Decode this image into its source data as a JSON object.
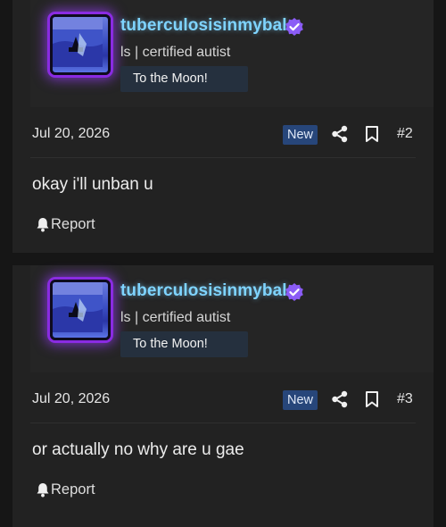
{
  "posts": [
    {
      "username": "tuberculosisinmybal",
      "user_title": "ls | certified autist",
      "banner": "To the Moon!",
      "date": "Jul 20, 2026",
      "badge": "New",
      "post_number": "#2",
      "message": "okay i'll unban u",
      "report_label": "Report"
    },
    {
      "username": "tuberculosisinmybal",
      "user_title": "ls | certified autist",
      "banner": "To the Moon!",
      "date": "Jul 20, 2026",
      "badge": "New",
      "post_number": "#3",
      "message": "or actually no why are u gae",
      "report_label": "Report"
    }
  ],
  "icons": {
    "verified": "verified-badge-icon",
    "share": "share-icon",
    "bookmark": "bookmark-icon",
    "report": "bell-icon"
  },
  "colors": {
    "username": "#7fd4ff",
    "verified": "#8b5cf6",
    "avatar_glow": "#8a2be2",
    "new_badge": "#27467a",
    "background": "#161616",
    "post": "#222222"
  }
}
